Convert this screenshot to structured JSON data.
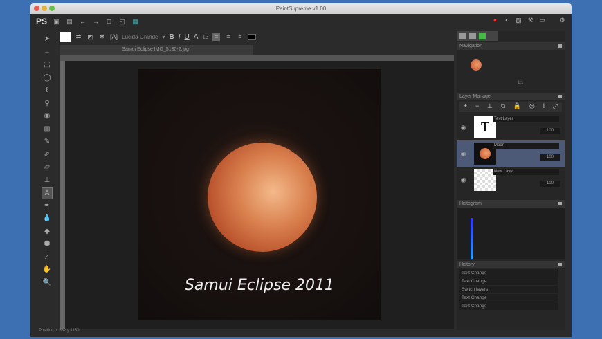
{
  "window": {
    "title": "PaintSupreme v1.00"
  },
  "topbar": {
    "logo": "PS"
  },
  "options": {
    "font": "Lucida Grande",
    "bold": "B",
    "italic": "I",
    "underline": "U",
    "aa": "A",
    "size": "13"
  },
  "document": {
    "tab": "Samui Eclipse IMG_5180-2.jpg*",
    "caption": "Samui Eclipse 2011"
  },
  "status": {
    "position": "Position: x:532 y:1160"
  },
  "panels": {
    "navigation": {
      "title": "Navigation",
      "zoom": "1:1"
    },
    "layers": {
      "title": "Layer Manager",
      "items": [
        {
          "name": "Text Layer",
          "opacity": "100",
          "thumb": "T"
        },
        {
          "name": "Moon",
          "opacity": "100"
        },
        {
          "name": "New Layer",
          "opacity": "100"
        }
      ]
    },
    "histogram": {
      "title": "Histogram"
    },
    "history": {
      "title": "History",
      "items": [
        "Text Change",
        "Text Change",
        "Switch layers",
        "Text Change",
        "Text Change"
      ]
    }
  }
}
